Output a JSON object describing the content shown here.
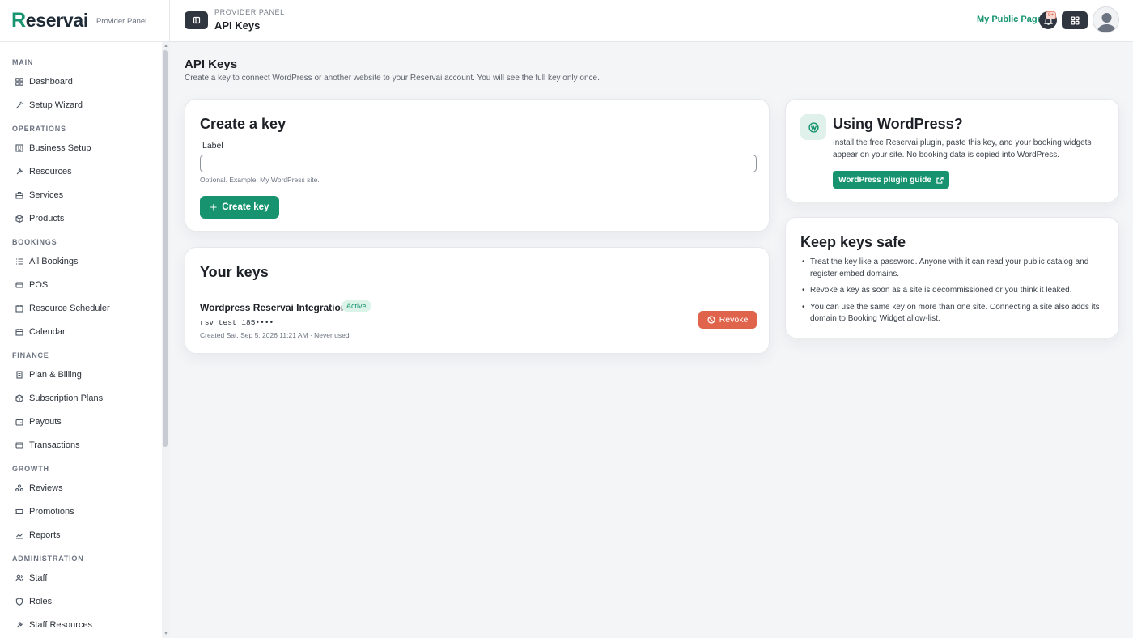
{
  "brand": {
    "name_initial": "R",
    "name_rest": "eservai",
    "subtitle": "Provider Panel"
  },
  "sidebar": {
    "groups": [
      {
        "label": "MAIN",
        "items": [
          {
            "label": "Dashboard",
            "icon": "dashboard-icon"
          },
          {
            "label": "Setup Wizard",
            "icon": "wand-icon"
          }
        ]
      },
      {
        "label": "OPERATIONS",
        "items": [
          {
            "label": "Business Setup",
            "icon": "building-icon"
          },
          {
            "label": "Resources",
            "icon": "tools-icon"
          },
          {
            "label": "Services",
            "icon": "briefcase-icon"
          },
          {
            "label": "Products",
            "icon": "box-icon"
          }
        ]
      },
      {
        "label": "BOOKINGS",
        "items": [
          {
            "label": "All Bookings",
            "icon": "list-icon"
          },
          {
            "label": "POS",
            "icon": "register-icon"
          },
          {
            "label": "Resource Scheduler",
            "icon": "calendar-icon"
          },
          {
            "label": "Calendar",
            "icon": "calendar-icon"
          }
        ]
      },
      {
        "label": "FINANCE",
        "items": [
          {
            "label": "Plan & Billing",
            "icon": "receipt-icon"
          },
          {
            "label": "Subscription Plans",
            "icon": "box-icon"
          },
          {
            "label": "Payouts",
            "icon": "wallet-icon"
          },
          {
            "label": "Transactions",
            "icon": "card-icon"
          }
        ]
      },
      {
        "label": "GROWTH",
        "items": [
          {
            "label": "Reviews",
            "icon": "people-icon"
          },
          {
            "label": "Promotions",
            "icon": "ticket-icon"
          },
          {
            "label": "Reports",
            "icon": "chart-icon"
          }
        ]
      },
      {
        "label": "ADMINISTRATION",
        "items": [
          {
            "label": "Staff",
            "icon": "user-icon"
          },
          {
            "label": "Roles",
            "icon": "shield-icon"
          },
          {
            "label": "Staff Resources",
            "icon": "tools-icon"
          }
        ]
      }
    ]
  },
  "header": {
    "kicker": "PROVIDER PANEL",
    "title": "API Keys",
    "public_link": "My Public Page",
    "notif_badge": "9+"
  },
  "page": {
    "title": "API Keys",
    "subtitle": "Create a key to connect WordPress or another website to your Reservai account. You will see the full key only once."
  },
  "create": {
    "title": "Create a key",
    "label": "Label",
    "value": "",
    "placeholder": "",
    "hint": "Optional. Example: My WordPress site.",
    "button": "Create key"
  },
  "keys": {
    "title": "Your keys",
    "items": [
      {
        "name": "Wordpress Reservai Integration",
        "status": "Active",
        "key": "rsv_test_185••••",
        "meta": "Created Sat, Sep 5, 2026 11:21 AM · Never used",
        "revoke": "Revoke"
      }
    ]
  },
  "wordpress": {
    "title": "Using WordPress?",
    "text": "Install the free Reservai plugin, paste this key, and your booking widgets appear on your site. No booking data is copied into WordPress.",
    "button": "WordPress plugin guide"
  },
  "safety": {
    "title": "Keep keys safe",
    "items": [
      "Treat the key like a password. Anyone with it can read your public catalog and register embed domains.",
      "Revoke a key as soon as a site is decommissioned or you think it leaked.",
      "You can use the same key on more than one site. Connecting a site also adds its domain to Booking Widget allow-list."
    ]
  },
  "colors": {
    "accent": "#17946f",
    "danger": "#e0644c",
    "dark": "#2f3640"
  }
}
